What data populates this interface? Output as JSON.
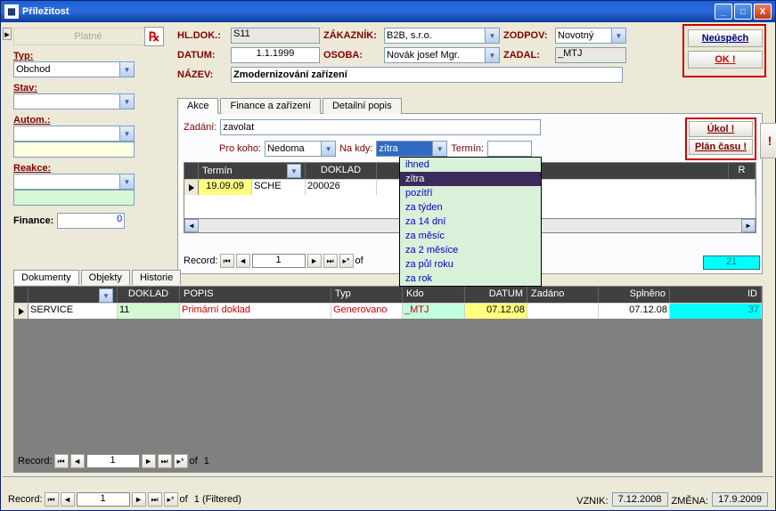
{
  "window": {
    "title": "Příležitost"
  },
  "winbtns": {
    "min": "_",
    "max": "□",
    "close": "X"
  },
  "left": {
    "platne": "Platné",
    "typ_label": "Typ:",
    "typ_value": "Obchod",
    "stav_label": "Stav:",
    "stav_value": "",
    "autom_label": "Autom.:",
    "autom_value": "",
    "reakce_label": "Reakce:",
    "reakce_value": "",
    "finance_label": "Finance:",
    "finance_value": "0"
  },
  "hdr": {
    "hldok_label": "HL.DOK.:",
    "hldok_value": "S11",
    "zakaznik_label": "ZÁKAZNÍK:",
    "zakaznik_value": "B2B, s.r.o.",
    "zodpov_label": "ZODPOV:",
    "zodpov_value": "Novotný",
    "datum_label": "DATUM:",
    "datum_value": "1.1.1999",
    "osoba_label": "OSOBA:",
    "osoba_value": "Novák josef Mgr.",
    "zadal_label": "ZADAL:",
    "zadal_value": "_MTJ",
    "nazev_label": "NÁZEV:",
    "nazev_value": "Zmodernizování zařízení"
  },
  "rightbtns": {
    "neuspech": "Neúspěch",
    "ok": "OK !"
  },
  "tabs": {
    "akce": "Akce",
    "finance": "Finance a zařízení",
    "detail": "Detailní popis"
  },
  "akce": {
    "zadani_label": "Zadání:",
    "zadani_value": "zavolat",
    "prokoho_label": "Pro koho:",
    "prokoho_value": "Nedoma",
    "nakdy_label": "Na kdy:",
    "nakdy_value": "zítra",
    "termin_label": "Termín:",
    "termin_value": "",
    "ukol_btn": "Úkol !",
    "plan_btn": "Plán času !"
  },
  "nakdy_options": [
    "ihned",
    "zítra",
    "pozítří",
    "za týden",
    "za 14 dní",
    "za měsíc",
    "za 2 měsíce",
    "za půl roku",
    "za rok"
  ],
  "akce_grid": {
    "cols": {
      "termin": "Termín",
      "doklad": "DOKLAD",
      "r": "R"
    },
    "row": {
      "termin": "19.09.09",
      "typ": "SCHE",
      "doklad": "200026"
    }
  },
  "recnav": {
    "label": "Record:",
    "value": "1",
    "of": "of",
    "total1": "1",
    "total2": "1 (Filtered)"
  },
  "cyan_badge": "21",
  "lowtabs": {
    "dokumenty": "Dokumenty",
    "objekty": "Objekty",
    "historie": "Historie"
  },
  "dok_grid": {
    "cols": {
      "blank": "",
      "doklad": "DOKLAD",
      "popis": "POPIS",
      "typ": "Typ",
      "kdo": "Kdo",
      "datum": "DATUM",
      "zadano": "Zadáno",
      "splneno": "Splněno",
      "id": "ID"
    },
    "row": {
      "c1": "SERVICE",
      "doklad": "11",
      "popis": "Primární doklad",
      "typ": "Generovano",
      "kdo": "_MTJ",
      "datum": "07.12.08",
      "zadano": "",
      "splneno": "07.12.08",
      "id": "37"
    }
  },
  "footer": {
    "vznik_label": "VZNIK:",
    "vznik_value": "7.12.2008",
    "zmena_label": "ZMĚNA:",
    "zmena_value": "17.9.2009"
  }
}
